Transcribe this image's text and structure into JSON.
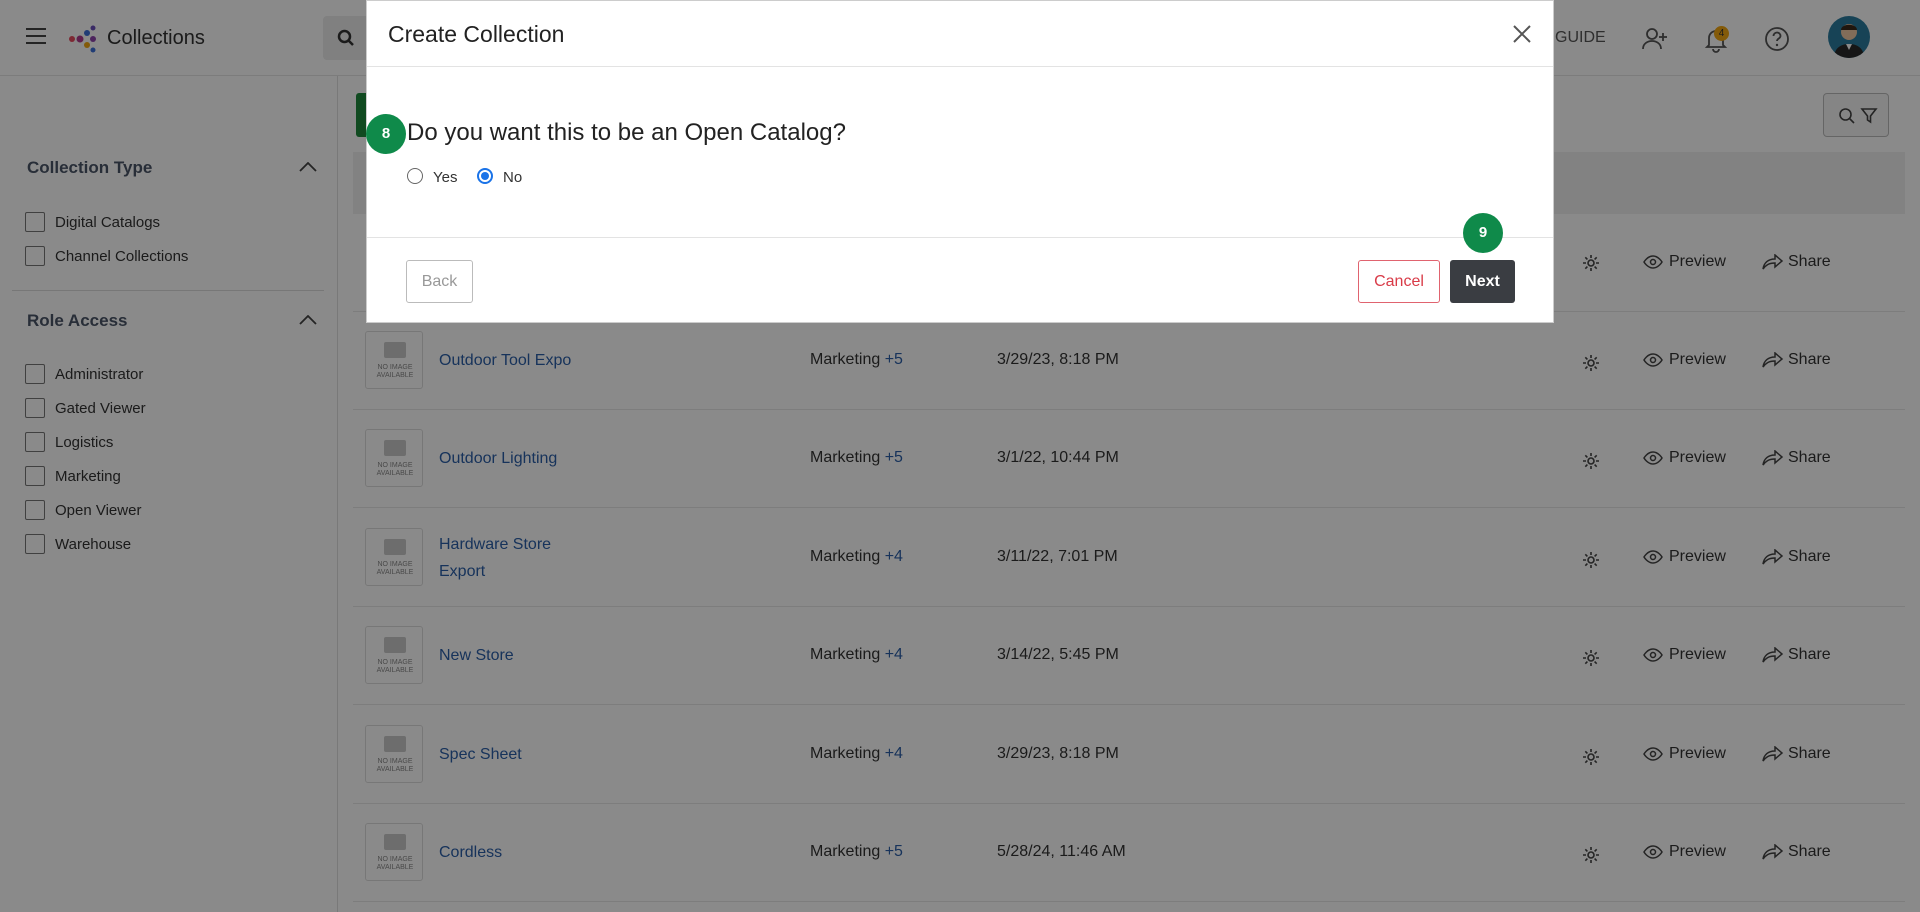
{
  "header": {
    "title": "Collections",
    "guide_label": "GUIDE",
    "notification_count": "4"
  },
  "sidebar": {
    "collection_type_heading": "Collection Type",
    "collection_types": [
      "Digital Catalogs",
      "Channel Collections"
    ],
    "role_access_heading": "Role Access",
    "roles": [
      "Administrator",
      "Gated Viewer",
      "Logistics",
      "Marketing",
      "Open Viewer",
      "Warehouse"
    ]
  },
  "table": {
    "preview_label": "Preview",
    "share_label": "Share",
    "no_image_text": "NO IMAGE AVAILABLE",
    "rows": [
      {
        "name": "",
        "role": "",
        "more": "",
        "date": ""
      },
      {
        "name": "Outdoor Tool Expo",
        "role": "Marketing",
        "more": "+5",
        "date": "3/29/23, 8:18 PM"
      },
      {
        "name": "Outdoor Lighting",
        "role": "Marketing",
        "more": "+5",
        "date": "3/1/22, 10:44 PM"
      },
      {
        "name": "Hardware Store Export",
        "role": "Marketing",
        "more": "+4",
        "date": "3/11/22, 7:01 PM"
      },
      {
        "name": "New Store",
        "role": "Marketing",
        "more": "+4",
        "date": "3/14/22, 5:45 PM"
      },
      {
        "name": "Spec Sheet",
        "role": "Marketing",
        "more": "+4",
        "date": "3/29/23, 8:18 PM"
      },
      {
        "name": "Cordless",
        "role": "Marketing",
        "more": "+5",
        "date": "5/28/24, 11:46 AM"
      }
    ]
  },
  "modal": {
    "title": "Create Collection",
    "question": "Do you want this to be an Open Catalog?",
    "options": [
      "Yes",
      "No"
    ],
    "selected": "No",
    "back_label": "Back",
    "cancel_label": "Cancel",
    "next_label": "Next"
  },
  "steps": {
    "question_step": "8",
    "next_step": "9"
  },
  "colors": {
    "accent_green": "#0f8a4a",
    "link_blue": "#2b5fa8",
    "cancel_red": "#d93b48",
    "next_dark": "#3a3d42"
  }
}
